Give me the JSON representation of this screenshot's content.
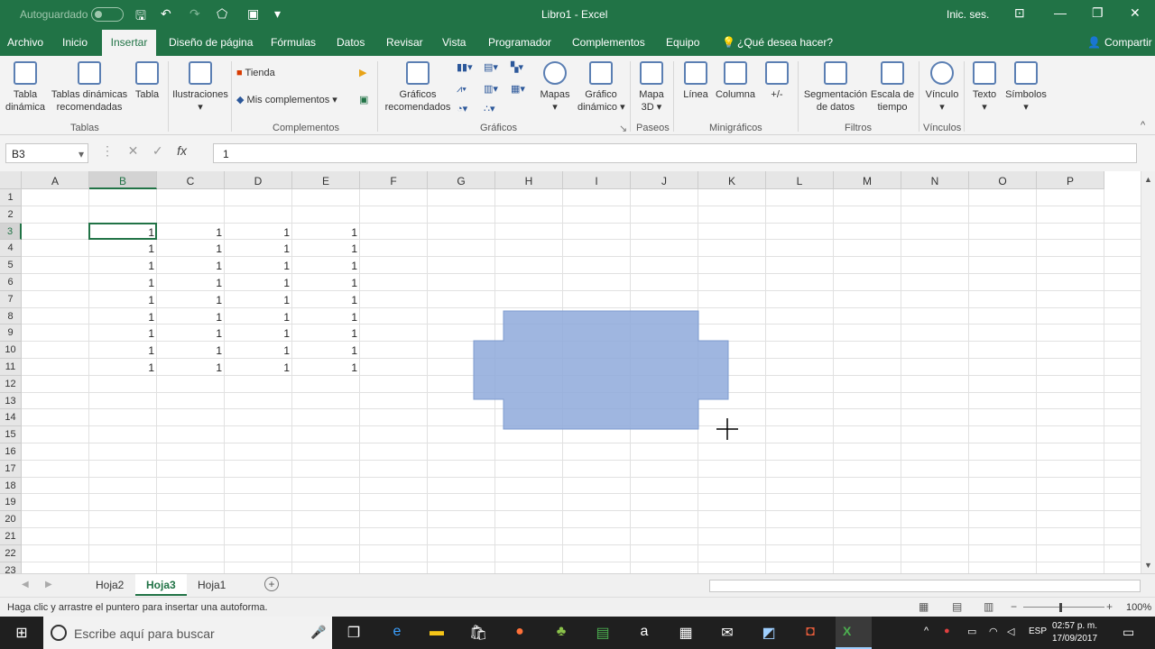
{
  "titlebar": {
    "autosave": "Autoguardado",
    "title": "Libro1  -  Excel",
    "signin": "Inic. ses."
  },
  "menu": {
    "tabs": [
      "Archivo",
      "Inicio",
      "Insertar",
      "Diseño de página",
      "Fórmulas",
      "Datos",
      "Revisar",
      "Vista",
      "Programador",
      "Complementos",
      "Equipo"
    ],
    "tellme": "¿Qué desea hacer?",
    "share": "Compartir"
  },
  "ribbon": {
    "tabla_dinamica": "Tabla\ndinámica",
    "tablas_recomendadas": "Tablas dinámicas\nrecomendadas",
    "tabla": "Tabla",
    "group_tablas": "Tablas",
    "ilustraciones": "Ilustraciones",
    "tienda": "Tienda",
    "mis_complementos": "Mis complementos",
    "group_complementos": "Complementos",
    "graficos_recomendados": "Gráficos\nrecomendados",
    "mapas": "Mapas",
    "grafico_dinamico": "Gráfico\ndinámico",
    "group_graficos": "Gráficos",
    "mapa3d": "Mapa\n3D",
    "group_paseos": "Paseos",
    "linea": "Línea",
    "columna": "Columna",
    "ganancia": "+/-",
    "group_minigraficos": "Minigráficos",
    "segmentacion": "Segmentación\nde datos",
    "escala": "Escala de\ntiempo",
    "group_filtros": "Filtros",
    "vinculo": "Vínculo",
    "group_vinculos": "Vínculos",
    "texto": "Texto",
    "simbolos": "Símbolos"
  },
  "formula": {
    "namebox": "B3",
    "value": "1"
  },
  "columns": [
    "A",
    "B",
    "C",
    "D",
    "E",
    "F",
    "G",
    "H",
    "I",
    "J",
    "K",
    "L",
    "M",
    "N",
    "O",
    "P"
  ],
  "rows": [
    "1",
    "2",
    "3",
    "4",
    "5",
    "6",
    "7",
    "8",
    "9",
    "10",
    "11",
    "12",
    "13",
    "14",
    "15",
    "16",
    "17",
    "18",
    "19",
    "20",
    "21",
    "22",
    "23"
  ],
  "cells": {
    "B": [
      "1",
      "1",
      "1",
      "1",
      "1",
      "1",
      "1",
      "1",
      "1"
    ],
    "C": [
      "1",
      "1",
      "1",
      "1",
      "1",
      "1",
      "1",
      "1",
      "1"
    ],
    "D": [
      "1",
      "1",
      "1",
      "1",
      "1",
      "1",
      "1",
      "1",
      "1"
    ],
    "E": [
      "1",
      "1",
      "1",
      "1",
      "1",
      "1",
      "1",
      "1",
      "1"
    ]
  },
  "sheets": [
    "Hoja2",
    "Hoja3",
    "Hoja1"
  ],
  "active_sheet": "Hoja3",
  "status": {
    "message": "Haga clic y arrastre el puntero para insertar una autoforma.",
    "zoom": "100%"
  },
  "taskbar": {
    "search": "Escribe aquí para buscar",
    "lang": "ESP",
    "time": "02:57 p. m.",
    "date": "17/09/2017"
  },
  "colors": {
    "accent": "#217346",
    "shape": "#8ea9db"
  }
}
